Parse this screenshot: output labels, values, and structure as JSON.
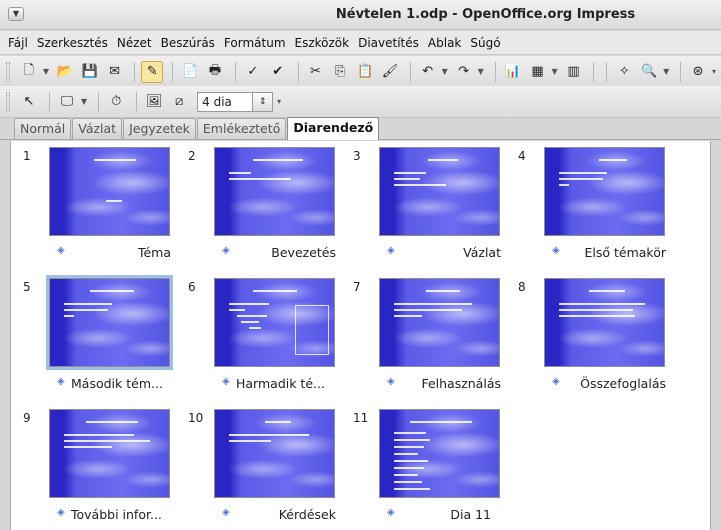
{
  "window": {
    "title": "Névtelen 1.odp - OpenOffice.org Impress"
  },
  "menu": [
    "Fájl",
    "Szerkesztés",
    "Nézet",
    "Beszúrás",
    "Formátum",
    "Eszközök",
    "Diavetítés",
    "Ablak",
    "Súgó"
  ],
  "toolbar2": {
    "slides_per_row": "4 dia"
  },
  "tabs": [
    "Normál",
    "Vázlat",
    "Jegyzetek",
    "Emlékeztető",
    "Diarendező"
  ],
  "slides": [
    {
      "n": "1",
      "label": "Téma"
    },
    {
      "n": "2",
      "label": "Bevezetés"
    },
    {
      "n": "3",
      "label": "Vázlat"
    },
    {
      "n": "4",
      "label": "Első témakör"
    },
    {
      "n": "5",
      "label": "Második tém..."
    },
    {
      "n": "6",
      "label": "Harmadik té..."
    },
    {
      "n": "7",
      "label": "Felhasználás"
    },
    {
      "n": "8",
      "label": "Összefoglalás"
    },
    {
      "n": "9",
      "label": "További infor..."
    },
    {
      "n": "10",
      "label": "Kérdések"
    },
    {
      "n": "11",
      "label": "Dia 11"
    }
  ],
  "colors": {
    "slide_bg": "#4a4ae0",
    "selection": "#9cc0e6",
    "active_tab": "#ffffff"
  }
}
